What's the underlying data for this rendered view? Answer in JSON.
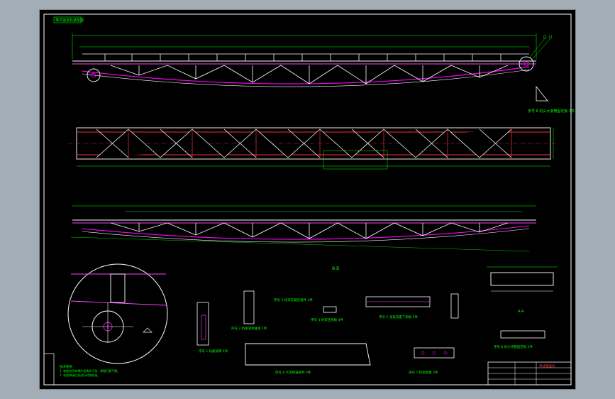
{
  "colors": {
    "background": "#a3adb6",
    "paper": "#000000",
    "frame": "#ffffff",
    "truss": "#ff00ff",
    "chord": "#ff44ff",
    "dimension": "#00ff00",
    "section": "#ff3030",
    "outline": "#ffffff"
  },
  "drawing": {
    "title_block_label": "带式输送机装配图",
    "section_label": "B-B",
    "detail_label": "A-A",
    "views": {
      "side": "侧视图",
      "plan": "俯视图",
      "bottom": "仰视图"
    },
    "parts": [
      {
        "label": "序号 1  机尾滚筒 1件"
      },
      {
        "label": "序号 2  机尾滚筒轴承 1件"
      },
      {
        "label": "序号 3  机架支腿连接件 4件"
      },
      {
        "label": "序号 4  机架连接板 4件"
      },
      {
        "label": "序号 5  张紧装置下架板 2件"
      },
      {
        "label": "序号 6  机头大滚筒固定板 2件"
      },
      {
        "label": "序号 7  机架后板 2件"
      },
      {
        "label": "序号 8  机头托辊固定板 2件"
      },
      {
        "label": "序号 9  大滚筒链接件 4件"
      }
    ],
    "notes": [
      "技术要求",
      "1. 装配前所有零件须清洗干净，焊缝打磨平整。",
      "2. 机架焊接后须进行时效处理。"
    ],
    "table_title": "带式输送机"
  },
  "chart_data": null
}
